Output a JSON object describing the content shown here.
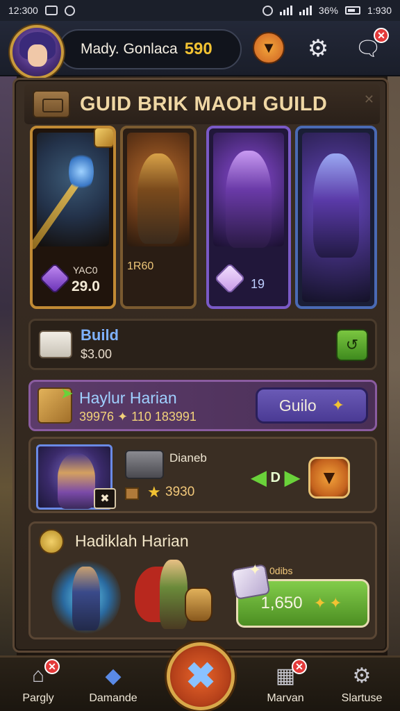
{
  "status_bar": {
    "time": "12:300",
    "right_text": "36%",
    "right_time": "1:930"
  },
  "header": {
    "player_name": "Mady. Gonlaca",
    "gold": "590"
  },
  "guild_panel": {
    "title": "GUID BRIK MAOH GUILD",
    "cards": [
      {
        "label": "YAC0",
        "value": "29.0"
      },
      {
        "value": "1R60"
      },
      {
        "value": "19"
      },
      {}
    ]
  },
  "build_row": {
    "label": "Build",
    "sub": "$3.00"
  },
  "daily_row": {
    "label": "Haylur Harian",
    "sub": "39976 ✦ 110 183991",
    "button_label": "Guilo"
  },
  "hero_row": {
    "name": "Dianeb",
    "gold": "3930",
    "mid_value": "D"
  },
  "reward_row": {
    "label": "Hadiklah Harian",
    "sub": "0dibs",
    "value": "1,650"
  },
  "bottom_nav": [
    {
      "label": "Pargly"
    },
    {
      "label": "Damande"
    },
    {
      "label": "Marvan"
    },
    {
      "label": "Slartuse"
    }
  ],
  "colors": {
    "gold": "#f2c232",
    "accent_purple": "#8a5ca0",
    "accent_green": "#6ad23a",
    "badge_red": "#e33a3a"
  },
  "icons": [
    "hero-avatar-icon",
    "shield-icon",
    "gear-icon",
    "chat-icon",
    "scroll-icon",
    "gem-icon",
    "folder-icon",
    "link-icon",
    "crate-icon",
    "star-icon",
    "armor-icon",
    "swords-icon",
    "arrow-icon",
    "home-icon",
    "diamond-icon",
    "battle-icon",
    "map-icon",
    "settings-icon"
  ]
}
